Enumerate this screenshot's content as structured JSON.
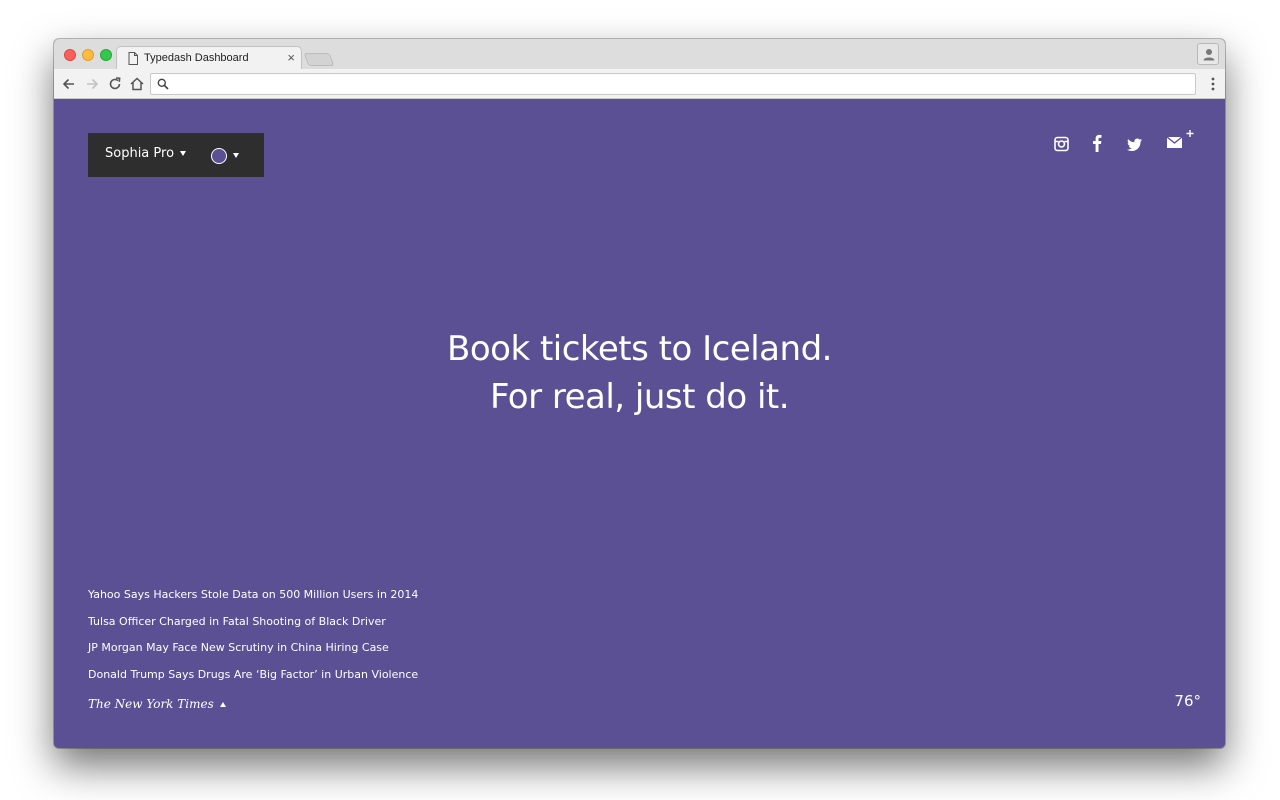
{
  "browser": {
    "tab_title": "Typedash Dashboard",
    "tab_close": "×",
    "address_value": "",
    "address_placeholder": ""
  },
  "controls": {
    "font_name": "Sophia Pro",
    "color_value": "#5b5094"
  },
  "social": [
    "instagram-icon",
    "facebook-icon",
    "twitter-icon",
    "mail-plus-icon"
  ],
  "headline": {
    "line1": "Book tickets to Iceland.",
    "line2": "For real, just do it."
  },
  "news": {
    "items": [
      "Yahoo Says Hackers Stole Data on 500 Million Users in 2014",
      "Tulsa Officer Charged in Fatal Shooting of Black Driver",
      "JP Morgan May Face New Scrutiny in China Hiring Case",
      "Donald Trump Says Drugs Are ‘Big Factor’ in Urban Violence"
    ],
    "source": "The New York Times"
  },
  "weather": {
    "temp": "76°"
  },
  "colors": {
    "background": "#5b5094",
    "panel": "#2e2e2e",
    "text": "#ffffff"
  }
}
